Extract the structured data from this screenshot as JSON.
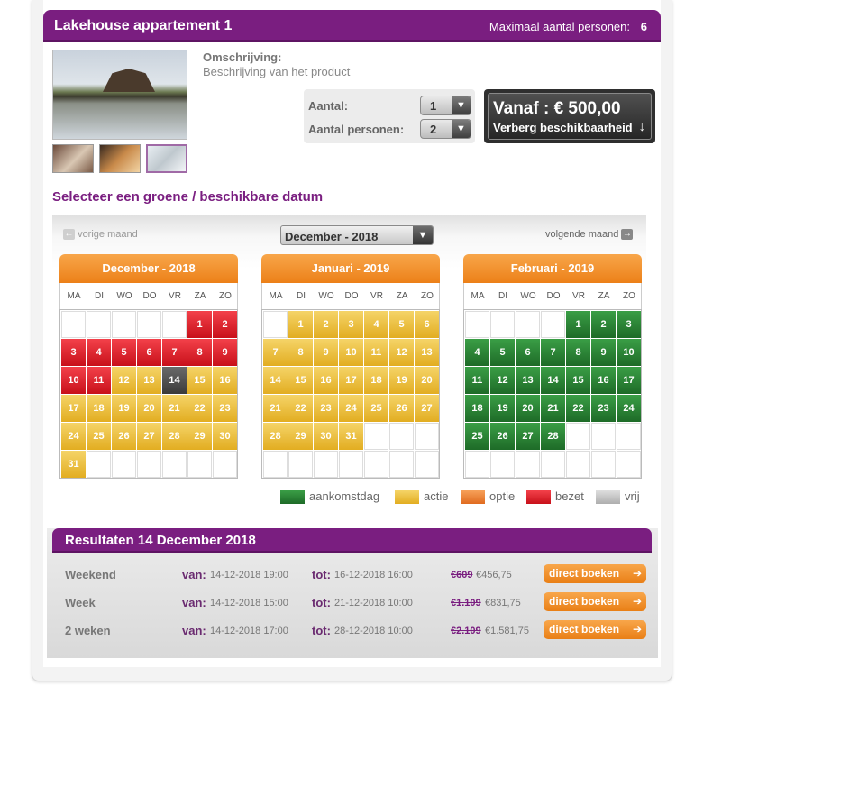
{
  "product": {
    "title": "Lakehouse appartement 1",
    "max_label": "Maximaal aantal personen:",
    "max_value": "6",
    "desc_label": "Omschrijving:",
    "desc_text": "Beschrijving van het product"
  },
  "form": {
    "aantal_label": "Aantal:",
    "aantal_value": "1",
    "personen_label": "Aantal personen:",
    "personen_value": "2"
  },
  "price": {
    "from": "Vanaf : € 500,00",
    "hide": "Verberg beschikbaarheid",
    "arrow": "↓"
  },
  "calendar": {
    "section_title": "Selecteer een groene / beschikbare datum",
    "prev_label": "vorige maand",
    "next_label": "volgende maand",
    "selected_month": "December - 2018",
    "weekdays": [
      "MA",
      "DI",
      "WO",
      "DO",
      "VR",
      "ZA",
      "ZO"
    ],
    "months": [
      {
        "title": "December - 2018",
        "offset": 5,
        "days": 31,
        "status": [
          "r",
          "r",
          "r",
          "r",
          "r",
          "r",
          "r",
          "r",
          "r",
          "r",
          "r",
          "y",
          "y",
          "d",
          "y",
          "y",
          "y",
          "y",
          "y",
          "y",
          "y",
          "y",
          "y",
          "y",
          "y",
          "y",
          "y",
          "y",
          "y",
          "y",
          "y"
        ]
      },
      {
        "title": "Januari - 2019",
        "offset": 1,
        "days": 31,
        "status": [
          "y",
          "y",
          "y",
          "y",
          "y",
          "y",
          "y",
          "y",
          "y",
          "y",
          "y",
          "y",
          "y",
          "y",
          "y",
          "y",
          "y",
          "y",
          "y",
          "y",
          "y",
          "y",
          "y",
          "y",
          "y",
          "y",
          "y",
          "y",
          "y",
          "y",
          "y"
        ]
      },
      {
        "title": "Februari - 2019",
        "offset": 4,
        "days": 28,
        "status": [
          "g",
          "g",
          "g",
          "g",
          "g",
          "g",
          "g",
          "g",
          "g",
          "g",
          "g",
          "g",
          "g",
          "g",
          "g",
          "g",
          "g",
          "g",
          "g",
          "g",
          "g",
          "g",
          "g",
          "g",
          "g",
          "g",
          "g",
          "g"
        ]
      }
    ]
  },
  "legend": [
    {
      "label": "aankomstdag",
      "color": "#2e8a3a"
    },
    {
      "label": "actie",
      "color": "#ecc440"
    },
    {
      "label": "optie",
      "color": "#ef8a3c"
    },
    {
      "label": "bezet",
      "color": "#e3222c"
    },
    {
      "label": "vrij",
      "color": "#c4c4c4"
    }
  ],
  "results": {
    "title": "Resultaten 14 December 2018",
    "van_label": "van:",
    "tot_label": "tot:",
    "button_label": "direct boeken",
    "rows": [
      {
        "name": "Weekend",
        "van": "14-12-2018 19:00",
        "tot": "16-12-2018 16:00",
        "old": "€609",
        "new": "€456,75"
      },
      {
        "name": "Week",
        "van": "14-12-2018 15:00",
        "tot": "21-12-2018 10:00",
        "old": "€1.109",
        "new": "€831,75"
      },
      {
        "name": "2 weken",
        "van": "14-12-2018 17:00",
        "tot": "28-12-2018 10:00",
        "old": "€2.109",
        "new": "€1.581,75"
      }
    ]
  }
}
